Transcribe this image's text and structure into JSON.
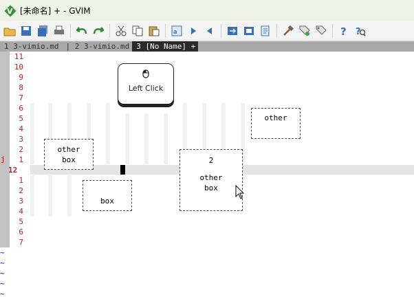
{
  "window": {
    "title": "[未命名] + - GVIM"
  },
  "toolbar": {
    "buttons": [
      "open-icon",
      "save-icon",
      "save-all-icon",
      "print-icon",
      "undo-icon",
      "redo-icon",
      "cut-icon",
      "copy-icon",
      "paste-icon",
      "find-replace-icon",
      "find-next-icon",
      "find-prev-icon",
      "load-session-icon",
      "save-session-icon",
      "run-script-icon",
      "make-icon",
      "run-ctags-icon",
      "jump-tag-icon",
      "help-icon",
      "find-help-icon"
    ]
  },
  "tabs": [
    {
      "label": "1 3-vimio.md",
      "active": false
    },
    {
      "label": "| 2 3-vimio.md",
      "active": false
    },
    {
      "label": "3 [No Name] +",
      "active": true
    }
  ],
  "editor": {
    "mark_char": "j",
    "line_numbers": [
      "11",
      "10",
      "9",
      "8",
      "7",
      "6",
      "5",
      "4",
      "3",
      "2",
      "1",
      "12",
      "1",
      "2",
      "3",
      "4",
      "5",
      "6",
      "7"
    ],
    "current_line_index": 11,
    "boxes": {
      "other_top": [
        "other"
      ],
      "other_box_left": [
        "other",
        "box"
      ],
      "two_other_box": [
        "2",
        "",
        "other",
        "box"
      ],
      "box_bottom": [
        "box"
      ]
    },
    "click_indicator": {
      "label": "Left Click"
    },
    "empty_line_marker": "~",
    "empty_lines": 5
  }
}
